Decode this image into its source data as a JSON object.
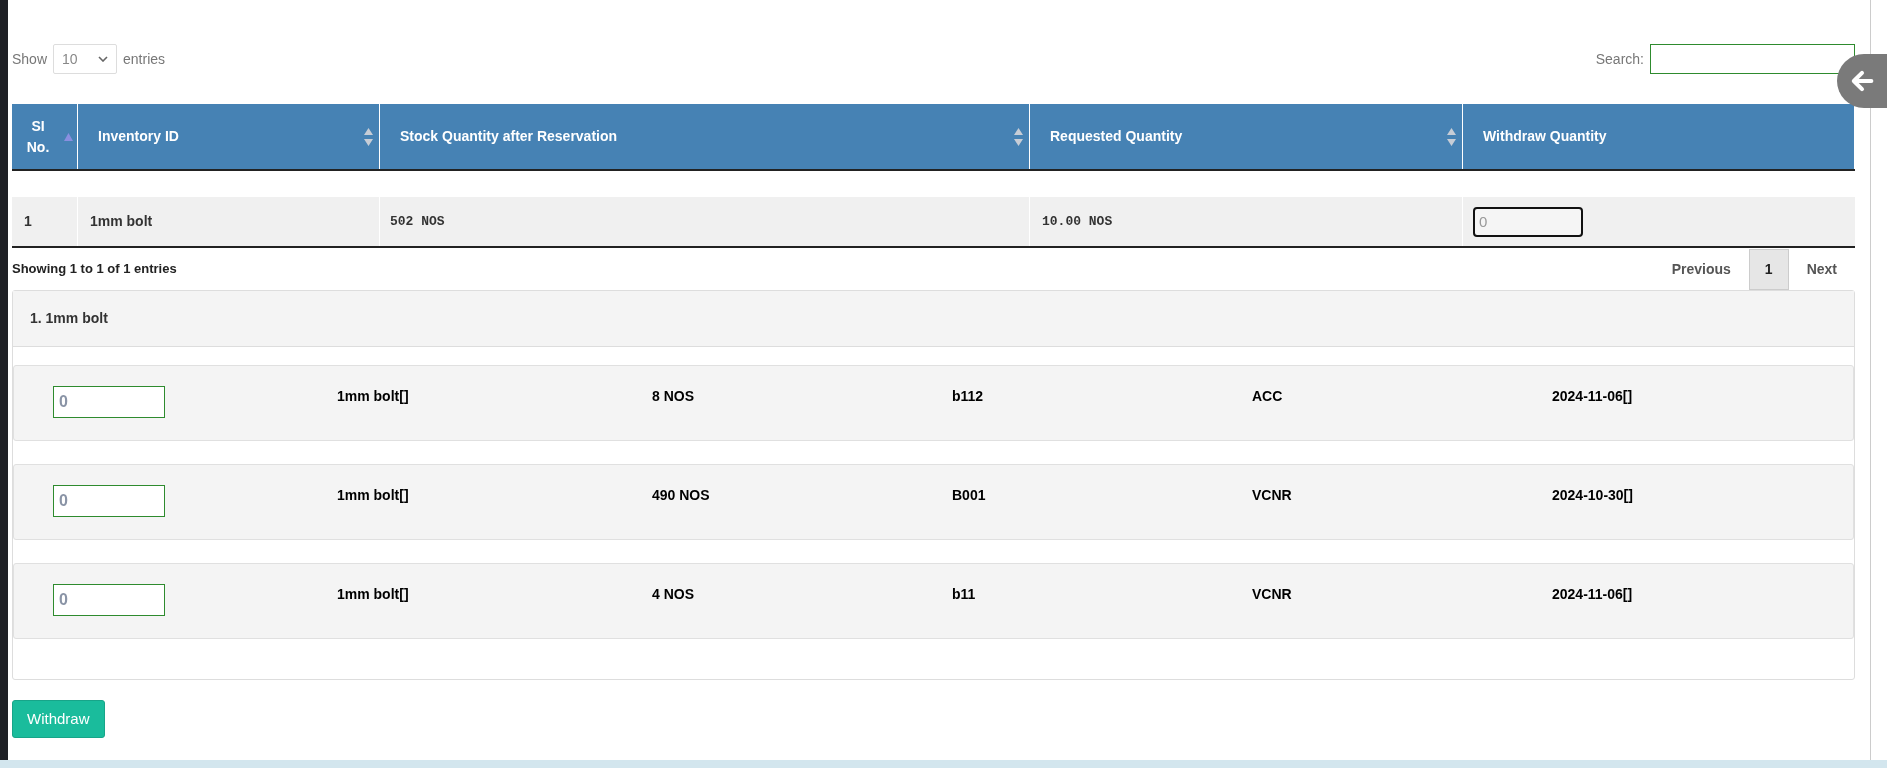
{
  "length_control": {
    "prefix": "Show",
    "value": "10",
    "suffix": "entries"
  },
  "search": {
    "label": "Search:"
  },
  "table": {
    "columns": [
      {
        "label": "SI No.",
        "sortable": true,
        "sorted": true
      },
      {
        "label": "Inventory ID",
        "sortable": true,
        "sorted": false
      },
      {
        "label": "Stock Quantity after Reservation",
        "sortable": true,
        "sorted": false
      },
      {
        "label": "Requested Quantity",
        "sortable": true,
        "sorted": false
      },
      {
        "label": "Withdraw Quantity",
        "sortable": false,
        "sorted": false
      }
    ],
    "rows": [
      {
        "sl": "1",
        "inventory_id": "1mm bolt",
        "stock_quantity": "502 NOS",
        "requested_quantity": "10.00 NOS",
        "withdraw_quantity": {
          "placeholder": "0"
        }
      }
    ]
  },
  "info": "Showing 1 to 1 of 1 entries",
  "pagination": {
    "previous": "Previous",
    "pages": [
      {
        "label": "1",
        "selected": true
      }
    ],
    "next": "Next"
  },
  "panel": {
    "title": "1. 1mm bolt",
    "lots": [
      {
        "placeholder": "0",
        "values": [
          "1mm bolt[]",
          "8 NOS",
          "b112",
          "ACC",
          "2024-11-06[]"
        ]
      },
      {
        "placeholder": "0",
        "values": [
          "1mm bolt[]",
          "490 NOS",
          "B001",
          "VCNR",
          "2024-10-30[]"
        ]
      },
      {
        "placeholder": "0",
        "values": [
          "1mm bolt[]",
          "4 NOS",
          "b11",
          "VCNR",
          "2024-11-06[]"
        ]
      }
    ]
  },
  "withdraw_button": "Withdraw"
}
